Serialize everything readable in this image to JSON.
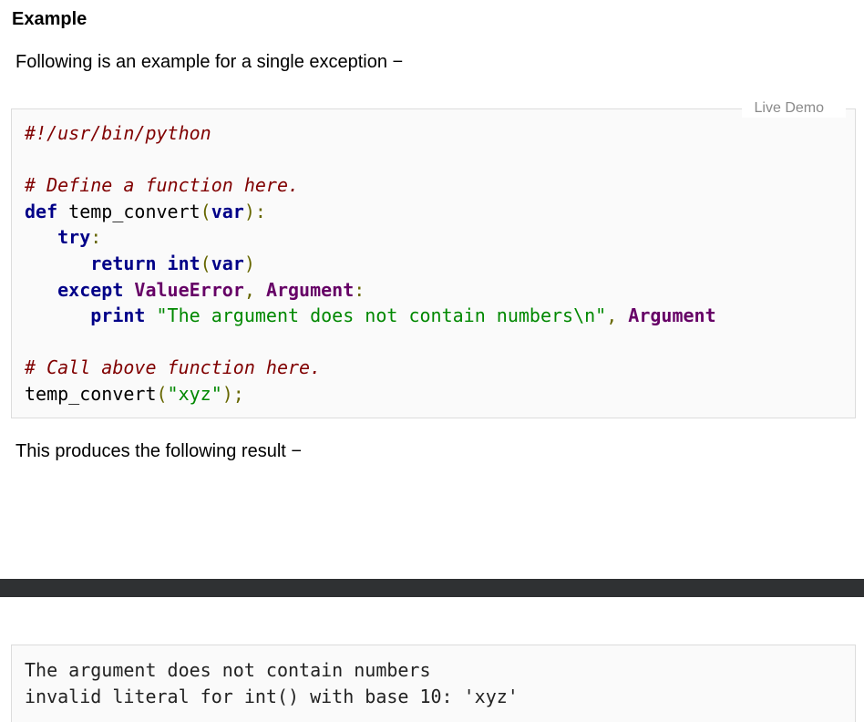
{
  "heading": "Example",
  "intro": "Following is an example for a single exception −",
  "live_demo_label": "Live Demo",
  "code": {
    "shebang": "#!/usr/bin/python",
    "comment_define": "# Define a function here.",
    "kw_def": "def",
    "func_name": " temp_convert",
    "kw_var": "var",
    "kw_try": "try",
    "kw_return": "return",
    "kw_int": "int",
    "kw_except": "except",
    "cls_valueerror": "ValueError",
    "cls_argument": "Argument",
    "kw_print": "print",
    "str_message": "\"The argument does not contain numbers\\n\"",
    "comment_call": "# Call above function here.",
    "call_name": "temp_convert",
    "str_xyz": "\"xyz\""
  },
  "result_intro": "This produces the following result −",
  "output": {
    "line1": "The argument does not contain numbers",
    "line2": "invalid literal for int() with base 10: 'xyz'"
  }
}
